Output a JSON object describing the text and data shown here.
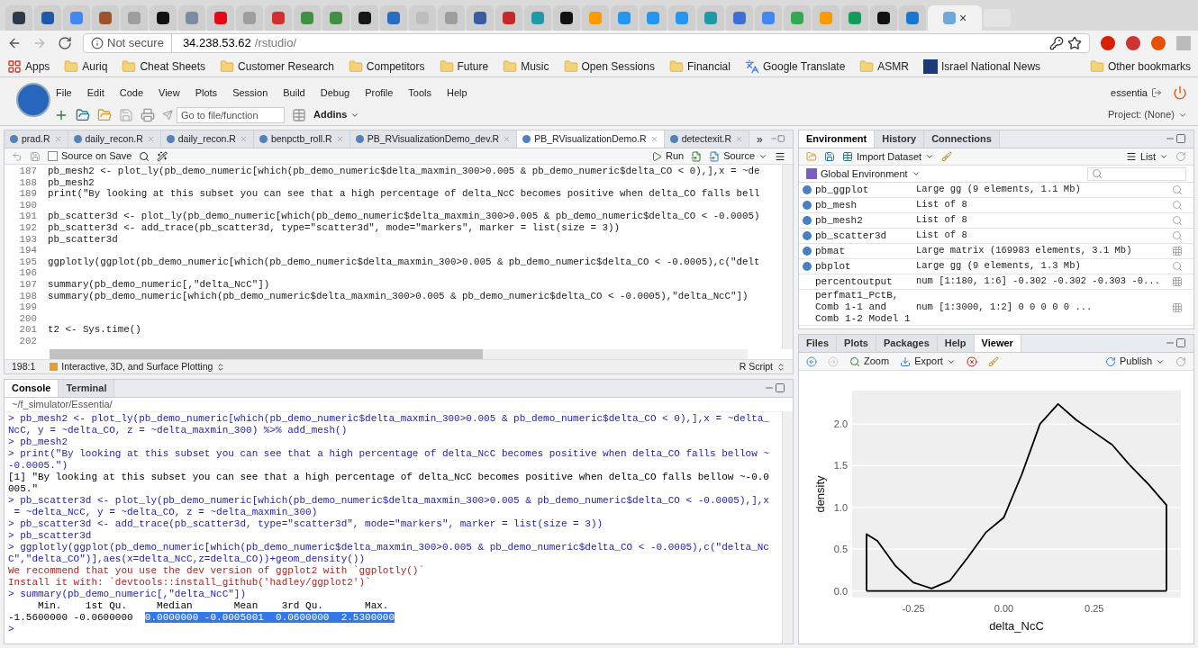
{
  "browser": {
    "tabs": [
      {
        "color": "#2b3a4a",
        "selected": false
      },
      {
        "color": "#1e5aa8",
        "selected": false
      },
      {
        "color": "#4285f4",
        "selected": false
      },
      {
        "color": "#a0522d",
        "selected": false
      },
      {
        "color": "#9e9e9e",
        "selected": false
      },
      {
        "color": "#111111",
        "selected": false
      },
      {
        "color": "#7a8ca0",
        "selected": false
      },
      {
        "color": "#e50914",
        "selected": false
      },
      {
        "color": "#9e9e9e",
        "selected": false
      },
      {
        "color": "#d32f2f",
        "selected": false
      },
      {
        "color": "#3f9142",
        "selected": false
      },
      {
        "color": "#3f9142",
        "selected": false
      },
      {
        "color": "#181717",
        "selected": false
      },
      {
        "color": "#276dc3",
        "selected": false
      },
      {
        "color": "#bdbdbd",
        "selected": false
      },
      {
        "color": "#9e9e9e",
        "selected": false
      },
      {
        "color": "#3b5ba5",
        "selected": false
      },
      {
        "color": "#c62828",
        "selected": false
      },
      {
        "color": "#1f9aa8",
        "selected": false
      },
      {
        "color": "#111111",
        "selected": false
      },
      {
        "color": "#ff9900",
        "selected": false
      },
      {
        "color": "#2196f3",
        "selected": false
      },
      {
        "color": "#2196f3",
        "selected": false
      },
      {
        "color": "#2196f3",
        "selected": false
      },
      {
        "color": "#1f9aa8",
        "selected": false
      },
      {
        "color": "#3d6fd6",
        "selected": false
      },
      {
        "color": "#4285f4",
        "selected": false
      },
      {
        "color": "#34a853",
        "selected": false
      },
      {
        "color": "#ff9900",
        "selected": false
      },
      {
        "color": "#0f9d58",
        "selected": false
      },
      {
        "color": "#111111",
        "selected": false
      },
      {
        "color": "#1976d2",
        "selected": false
      },
      {
        "color": "#6fa8dc",
        "selected": true
      }
    ],
    "close_label": "×",
    "security": "Not secure",
    "url_host": "34.238.53.62",
    "url_path": "/rstudio/",
    "bookmarks": [
      {
        "kind": "apps",
        "label": "Apps"
      },
      {
        "kind": "folder",
        "label": "Auriq"
      },
      {
        "kind": "folder",
        "label": "Cheat Sheets"
      },
      {
        "kind": "folder",
        "label": "Customer Research"
      },
      {
        "kind": "folder",
        "label": "Competitors"
      },
      {
        "kind": "folder",
        "label": "Future"
      },
      {
        "kind": "folder",
        "label": "Music"
      },
      {
        "kind": "folder",
        "label": "Open Sessions"
      },
      {
        "kind": "folder",
        "label": "Financial"
      },
      {
        "kind": "translate",
        "label": "Google Translate"
      },
      {
        "kind": "folder",
        "label": "ASMR"
      },
      {
        "kind": "news",
        "label": "Israel National News"
      }
    ],
    "other_bookmarks": "Other bookmarks"
  },
  "menu": {
    "items": [
      "File",
      "Edit",
      "Code",
      "View",
      "Plots",
      "Session",
      "Build",
      "Debug",
      "Profile",
      "Tools",
      "Help"
    ],
    "user": "essentia"
  },
  "toolbar": {
    "goto_placeholder": "Go to file/function",
    "addins": "Addins",
    "project": "Project: (None)"
  },
  "editor": {
    "tabs": [
      {
        "label": "prad.R",
        "selected": false
      },
      {
        "label": "daily_recon.R",
        "selected": false
      },
      {
        "label": "daily_recon.R",
        "selected": false
      },
      {
        "label": "benpctb_roll.R",
        "selected": false
      },
      {
        "label": "PB_RVisualizationDemo_dev.R",
        "selected": false
      },
      {
        "label": "PB_RVisualizationDemo.R",
        "selected": true
      },
      {
        "label": "detectexit.R",
        "selected": false
      }
    ],
    "overflow": "»",
    "source_on_save": {
      "label": "Source on Save",
      "checked": false
    },
    "run": "Run",
    "source": "Source",
    "lines": [
      {
        "number": "187",
        "text": "pb_mesh2 <- plot_ly(pb_demo_numeric[which(pb_demo_numeric$delta_maxmin_300>0.005 & pb_demo_numeric$delta_CO < 0),],x = ~de"
      },
      {
        "number": "188",
        "text": "pb_mesh2"
      },
      {
        "number": "189",
        "text": "print(\"By looking at this subset you can see that a high percentage of delta_NcC becomes positive when delta_CO falls bell"
      },
      {
        "number": "190"
      },
      {
        "number": "191",
        "text": "pb_scatter3d <- plot_ly(pb_demo_numeric[which(pb_demo_numeric$delta_maxmin_300>0.005 & pb_demo_numeric$delta_CO < -0.0005)"
      },
      {
        "number": "192",
        "text": "pb_scatter3d <- add_trace(pb_scatter3d, type=\"scatter3d\", mode=\"markers\", marker = list(size = 3))"
      },
      {
        "number": "193",
        "text": "pb_scatter3d"
      },
      {
        "number": "194"
      },
      {
        "number": "195",
        "text": "ggplotly(ggplot(pb_demo_numeric[which(pb_demo_numeric$delta_maxmin_300>0.005 & pb_demo_numeric$delta_CO < -0.0005),c(\"delt"
      },
      {
        "number": "196"
      },
      {
        "number": "197",
        "text": "summary(pb_demo_numeric[,\"delta_NcC\"])"
      },
      {
        "number": "198",
        "text": "summary(pb_demo_numeric[which(pb_demo_numeric$delta_maxmin_300>0.005 & pb_demo_numeric$delta_CO < -0.0005),\"delta_NcC\"])"
      },
      {
        "number": "199"
      },
      {
        "number": "200"
      },
      {
        "number": "201",
        "text": "t2 <- Sys.time()"
      },
      {
        "number": "202"
      }
    ],
    "position": "198:1",
    "section": "Interactive, 3D, and Surface Plotting",
    "file_type": "R Script"
  },
  "console": {
    "tabs": [
      {
        "label": "Console",
        "selected": true
      },
      {
        "label": "Terminal",
        "selected": false
      }
    ],
    "path": "~/f_simulator/Essentia/",
    "lines": [
      {
        "kind": "command",
        "text": "> pb_mesh2 <- plot_ly(pb_demo_numeric[which(pb_demo_numeric$delta_maxmin_300>0.005 & pb_demo_numeric$delta_CO < 0),],x = ~delta_"
      },
      {
        "kind": "command",
        "text": "NcC, y = ~delta_CO, z = ~delta_maxmin_300) %>% add_mesh()"
      },
      {
        "kind": "command",
        "text": "> pb_mesh2"
      },
      {
        "kind": "command",
        "text": "> print(\"By looking at this subset you can see that a high percentage of delta_NcC becomes positive when delta_CO falls bellow ~"
      },
      {
        "kind": "command",
        "text": "-0.0005.\")"
      },
      {
        "kind": "output",
        "text": "[1] \"By looking at this subset you can see that a high percentage of delta_NcC becomes positive when delta_CO falls bellow ~-0.0"
      },
      {
        "kind": "output",
        "text": "005.\""
      },
      {
        "kind": "command",
        "text": "> pb_scatter3d <- plot_ly(pb_demo_numeric[which(pb_demo_numeric$delta_maxmin_300>0.005 & pb_demo_numeric$delta_CO < -0.0005),],x"
      },
      {
        "kind": "command",
        "text": " = ~delta_NcC, y = ~delta_CO, z = ~delta_maxmin_300)"
      },
      {
        "kind": "command",
        "text": "> pb_scatter3d <- add_trace(pb_scatter3d, type=\"scatter3d\", mode=\"markers\", marker = list(size = 3))"
      },
      {
        "kind": "command",
        "text": "> pb_scatter3d"
      },
      {
        "kind": "command",
        "text": "> ggplotly(ggplot(pb_demo_numeric[which(pb_demo_numeric$delta_maxmin_300>0.005 & pb_demo_numeric$delta_CO < -0.0005),c(\"delta_Nc"
      },
      {
        "kind": "command",
        "text": "C\",\"delta_CO\")],aes(x=delta_NcC,z=delta_CO))+geom_density())"
      },
      {
        "kind": "warning",
        "text": "We recommend that you use the dev version of ggplot2 with `ggplotly()`"
      },
      {
        "kind": "warning",
        "text": "Install it with: `devtools::install_github('hadley/ggplot2')`"
      },
      {
        "kind": "command",
        "text": "> summary(pb_demo_numeric[,\"delta_NcC\"])"
      },
      {
        "kind": "output",
        "text": "     Min.    1st Qu.     Median       Mean    3rd Qu.       Max."
      },
      {
        "kind": "output",
        "text": "-1.5600000 -0.0600000  ",
        "highlight": "0.0000000 -0.0005001  0.0600000  2.5300000"
      }
    ],
    "prompt": ">"
  },
  "environment": {
    "tabs": [
      {
        "label": "Environment",
        "selected": true
      },
      {
        "label": "History",
        "selected": false
      },
      {
        "label": "Connections",
        "selected": false
      }
    ],
    "import": "Import Dataset",
    "view": "List",
    "scope": "Global Environment",
    "rows": [
      {
        "name": "pb_ggplot",
        "value": "Large gg (9 elements, 1.1 Mb)",
        "expandable": true,
        "kind": "inspect"
      },
      {
        "name": "pb_mesh",
        "value": "List of 8",
        "expandable": true,
        "kind": "inspect"
      },
      {
        "name": "pb_mesh2",
        "value": "List of 8",
        "expandable": true,
        "kind": "inspect"
      },
      {
        "name": "pb_scatter3d",
        "value": "List of 8",
        "expandable": true,
        "kind": "inspect"
      },
      {
        "name": "pbmat",
        "value": "Large matrix (169983 elements, 3.1 Mb)",
        "expandable": true,
        "kind": "table"
      },
      {
        "name": "pbplot",
        "value": "Large gg (9 elements, 1.3 Mb)",
        "expandable": true,
        "kind": "inspect"
      },
      {
        "name": "percentoutput",
        "value": "num [1:180, 1:6] -0.302 -0.302 -0.303 -0...",
        "expandable": false,
        "kind": "table"
      },
      {
        "name": "perfmat1_PctB, Comb 1-1 and Comb 1-2 Model 1",
        "value": "num [1:3000, 1:2] 0 0 0 0 0 ...",
        "expandable": false,
        "kind": "table"
      }
    ]
  },
  "viewer": {
    "tabs": [
      {
        "label": "Files",
        "selected": false
      },
      {
        "label": "Plots",
        "selected": false
      },
      {
        "label": "Packages",
        "selected": false
      },
      {
        "label": "Help",
        "selected": false
      },
      {
        "label": "Viewer",
        "selected": true
      }
    ],
    "zoom": "Zoom",
    "export": "Export",
    "publish": "Publish",
    "chart_data": {
      "type": "line",
      "xlabel": "delta_NcC",
      "ylabel": "density",
      "x": [
        -0.38,
        -0.38,
        -0.35,
        -0.3,
        -0.25,
        -0.2,
        -0.15,
        -0.1,
        -0.05,
        0.0,
        0.05,
        0.1,
        0.15,
        0.2,
        0.25,
        0.3,
        0.35,
        0.4,
        0.45,
        0.45
      ],
      "ref_lines": [
        {
          "axis": "y",
          "value": 0
        }
      ],
      "xlim": [
        -0.42,
        0.49
      ],
      "ylim": [
        -0.08,
        2.4
      ],
      "grid": true,
      "series": [
        {
          "color": "#000000",
          "values": [
            0,
            0.68,
            0.6,
            0.3,
            0.1,
            0.03,
            0.12,
            0.4,
            0.7,
            0.88,
            1.4,
            2.0,
            2.24,
            2.05,
            1.9,
            1.75,
            1.5,
            1.28,
            1.03,
            0
          ]
        }
      ],
      "xticks": [
        {
          "value": -0.25,
          "label": "-0.25"
        },
        {
          "value": 0,
          "label": "0.00"
        },
        {
          "value": 0.25,
          "label": "0.25"
        }
      ],
      "yticks": [
        {
          "value": 0,
          "label": "0.0"
        },
        {
          "value": 0.5,
          "label": "0.5"
        },
        {
          "value": 1,
          "label": "1.0"
        },
        {
          "value": 1.5,
          "label": "1.5"
        },
        {
          "value": 2,
          "label": "2.0"
        }
      ]
    }
  }
}
